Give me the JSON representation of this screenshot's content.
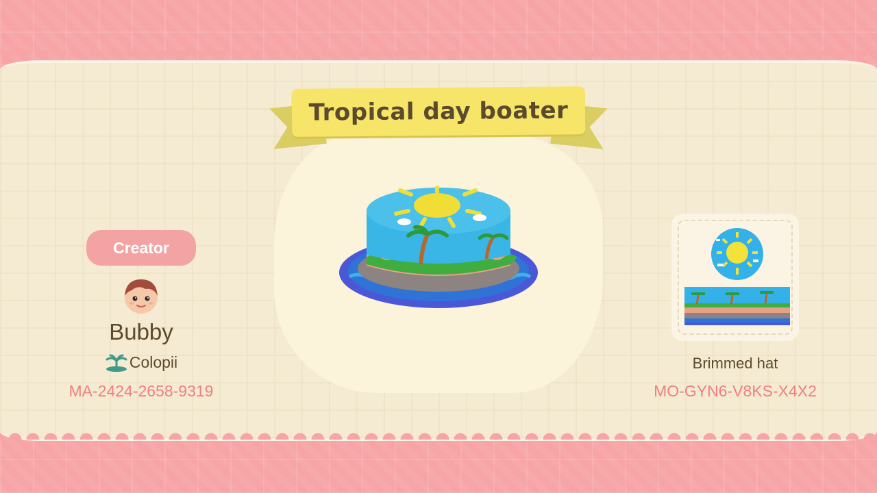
{
  "design": {
    "title": "Tropical day boater",
    "type": "Brimmed hat",
    "design_id": "MO-GYN6-V8KS-X4X2"
  },
  "creator": {
    "badge_label": "Creator",
    "name": "Bubby",
    "island": "Colopii",
    "creator_id": "MA-2424-2658-9319",
    "avatar_icon": "villager-face-icon",
    "island_icon": "island-palm-icon"
  },
  "colors": {
    "background_pink": "#f7a4a6",
    "panel_cream": "#f5ebd2",
    "banner_yellow": "#f6e569",
    "accent_pink_text": "#f07f7f",
    "brown_text": "#5b4a2c"
  }
}
